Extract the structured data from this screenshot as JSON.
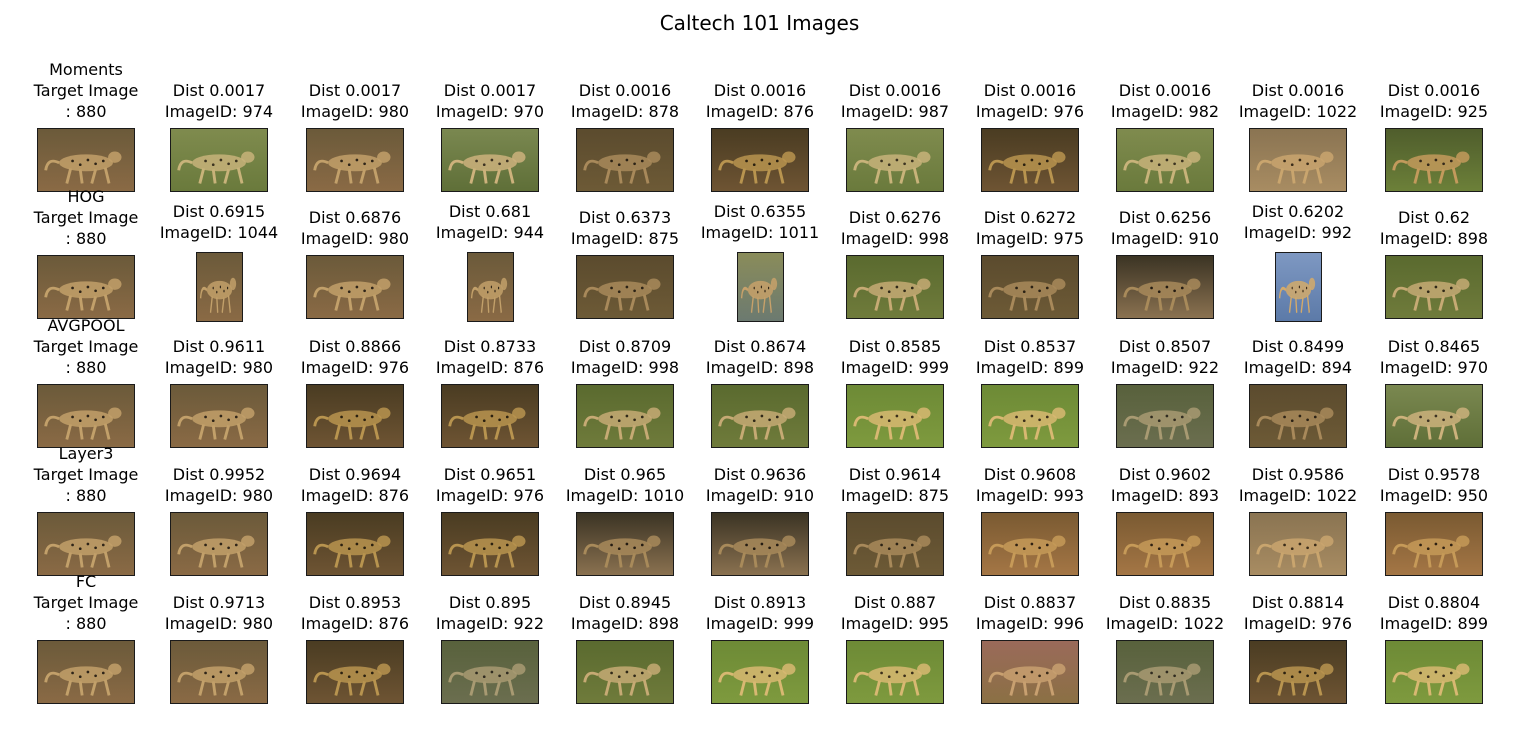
{
  "title": "Caltech 101 Images",
  "rows": [
    {
      "method": "Moments",
      "target": {
        "line1": "Target Image",
        "line2": ": 880",
        "scene": "cheetah-walk-dirt"
      },
      "results": [
        {
          "dist": "Dist 0.0017",
          "id": "ImageID: 974",
          "scene": "cheetahs-grass",
          "shape": "wide"
        },
        {
          "dist": "Dist 0.0017",
          "id": "ImageID: 980",
          "scene": "cheetah-walk-dirt",
          "shape": "wide"
        },
        {
          "dist": "Dist 0.0017",
          "id": "ImageID: 970",
          "scene": "cheetah-grass-run",
          "shape": "wide"
        },
        {
          "dist": "Dist 0.0016",
          "id": "ImageID: 878",
          "scene": "cheetah-dim-field",
          "shape": "wide"
        },
        {
          "dist": "Dist 0.0016",
          "id": "ImageID: 876",
          "scene": "cheetah-walk-dark",
          "shape": "wide"
        },
        {
          "dist": "Dist 0.0016",
          "id": "ImageID: 987",
          "scene": "cheetahs-grass",
          "shape": "wide"
        },
        {
          "dist": "Dist 0.0016",
          "id": "ImageID: 976",
          "scene": "cheetah-walk-dark",
          "shape": "wide"
        },
        {
          "dist": "Dist 0.0016",
          "id": "ImageID: 982",
          "scene": "cheetahs-grass",
          "shape": "wide"
        },
        {
          "dist": "Dist 0.0016",
          "id": "ImageID: 1022",
          "scene": "cheetah-walk-sand",
          "shape": "wide"
        },
        {
          "dist": "Dist 0.0016",
          "id": "ImageID: 925",
          "scene": "cheetah-tree-grass",
          "shape": "wide"
        }
      ]
    },
    {
      "method": "HOG",
      "target": {
        "line1": "Target Image",
        "line2": ": 880",
        "scene": "cheetah-walk-dirt"
      },
      "results": [
        {
          "dist": "Dist 0.6915",
          "id": "ImageID: 1044",
          "scene": "cheetah-walk-dirt",
          "shape": "tall"
        },
        {
          "dist": "Dist 0.6876",
          "id": "ImageID: 980",
          "scene": "cheetah-walk-dirt",
          "shape": "wide"
        },
        {
          "dist": "Dist 0.681",
          "id": "ImageID: 944",
          "scene": "cheetah-walk-dirt",
          "shape": "tall"
        },
        {
          "dist": "Dist 0.6373",
          "id": "ImageID: 875",
          "scene": "cheetah-dim-field",
          "shape": "wide"
        },
        {
          "dist": "Dist 0.6355",
          "id": "ImageID: 1011",
          "scene": "cheetah-water",
          "shape": "tall"
        },
        {
          "dist": "Dist 0.6276",
          "id": "ImageID: 998",
          "scene": "cheetah-grass-walk",
          "shape": "wide"
        },
        {
          "dist": "Dist 0.6272",
          "id": "ImageID: 975",
          "scene": "cheetah-dim-field",
          "shape": "wide"
        },
        {
          "dist": "Dist 0.6256",
          "id": "ImageID: 910",
          "scene": "cheetah-shadow",
          "shape": "wide"
        },
        {
          "dist": "Dist 0.6202",
          "id": "ImageID: 992",
          "scene": "cheetah-face-sky",
          "shape": "tall"
        },
        {
          "dist": "Dist 0.62",
          "id": "ImageID: 898",
          "scene": "cheetah-grass-walk",
          "shape": "wide"
        }
      ]
    },
    {
      "method": "AVGPOOL",
      "target": {
        "line1": "Target Image",
        "line2": ": 880",
        "scene": "cheetah-walk-dirt"
      },
      "results": [
        {
          "dist": "Dist 0.9611",
          "id": "ImageID: 980",
          "scene": "cheetah-walk-dirt",
          "shape": "wide"
        },
        {
          "dist": "Dist 0.8866",
          "id": "ImageID: 976",
          "scene": "cheetah-walk-dark",
          "shape": "wide"
        },
        {
          "dist": "Dist 0.8733",
          "id": "ImageID: 876",
          "scene": "cheetah-walk-dark",
          "shape": "wide"
        },
        {
          "dist": "Dist 0.8709",
          "id": "ImageID: 998",
          "scene": "cheetah-grass-walk",
          "shape": "wide"
        },
        {
          "dist": "Dist 0.8674",
          "id": "ImageID: 898",
          "scene": "cheetah-grass-walk",
          "shape": "wide"
        },
        {
          "dist": "Dist 0.8585",
          "id": "ImageID: 999",
          "scene": "cheetah-bright-grass",
          "shape": "wide"
        },
        {
          "dist": "Dist 0.8537",
          "id": "ImageID: 899",
          "scene": "cheetah-bright-grass",
          "shape": "wide"
        },
        {
          "dist": "Dist 0.8507",
          "id": "ImageID: 922",
          "scene": "cheetah-grey-ground",
          "shape": "wide"
        },
        {
          "dist": "Dist 0.8499",
          "id": "ImageID: 894",
          "scene": "cheetah-dim-field",
          "shape": "wide"
        },
        {
          "dist": "Dist 0.8465",
          "id": "ImageID: 970",
          "scene": "cheetah-grass-run",
          "shape": "wide"
        }
      ]
    },
    {
      "method": "Layer3",
      "target": {
        "line1": "Target Image",
        "line2": ": 880",
        "scene": "cheetah-walk-dirt"
      },
      "results": [
        {
          "dist": "Dist 0.9952",
          "id": "ImageID: 980",
          "scene": "cheetah-walk-dirt",
          "shape": "wide"
        },
        {
          "dist": "Dist 0.9694",
          "id": "ImageID: 876",
          "scene": "cheetah-walk-dark",
          "shape": "wide"
        },
        {
          "dist": "Dist 0.9651",
          "id": "ImageID: 976",
          "scene": "cheetah-walk-dark",
          "shape": "wide"
        },
        {
          "dist": "Dist 0.965",
          "id": "ImageID: 1010",
          "scene": "cheetah-shadow",
          "shape": "wide"
        },
        {
          "dist": "Dist 0.9636",
          "id": "ImageID: 910",
          "scene": "cheetah-shadow",
          "shape": "wide"
        },
        {
          "dist": "Dist 0.9614",
          "id": "ImageID: 875",
          "scene": "cheetah-dim-field",
          "shape": "wide"
        },
        {
          "dist": "Dist 0.9608",
          "id": "ImageID: 993",
          "scene": "cheetah-orange-dirt",
          "shape": "wide"
        },
        {
          "dist": "Dist 0.9602",
          "id": "ImageID: 893",
          "scene": "cheetah-orange-dirt",
          "shape": "wide"
        },
        {
          "dist": "Dist 0.9586",
          "id": "ImageID: 1022",
          "scene": "cheetah-walk-sand",
          "shape": "wide"
        },
        {
          "dist": "Dist 0.9578",
          "id": "ImageID: 950",
          "scene": "cheetah-orange-dirt",
          "shape": "wide"
        }
      ]
    },
    {
      "method": "FC",
      "target": {
        "line1": "Target Image",
        "line2": ": 880",
        "scene": "cheetah-walk-dirt"
      },
      "results": [
        {
          "dist": "Dist 0.9713",
          "id": "ImageID: 980",
          "scene": "cheetah-walk-dirt",
          "shape": "wide"
        },
        {
          "dist": "Dist 0.8953",
          "id": "ImageID: 876",
          "scene": "cheetah-walk-dark",
          "shape": "wide"
        },
        {
          "dist": "Dist 0.895",
          "id": "ImageID: 922",
          "scene": "cheetah-grey-ground",
          "shape": "wide"
        },
        {
          "dist": "Dist 0.8945",
          "id": "ImageID: 898",
          "scene": "cheetah-grass-walk",
          "shape": "wide"
        },
        {
          "dist": "Dist 0.8913",
          "id": "ImageID: 999",
          "scene": "cheetah-bright-grass",
          "shape": "wide"
        },
        {
          "dist": "Dist 0.887",
          "id": "ImageID: 995",
          "scene": "cheetah-bright-grass",
          "shape": "wide"
        },
        {
          "dist": "Dist 0.8837",
          "id": "ImageID: 996",
          "scene": "cheetah-pink-grass",
          "shape": "wide"
        },
        {
          "dist": "Dist 0.8835",
          "id": "ImageID: 1022",
          "scene": "cheetah-grey-ground",
          "shape": "wide"
        },
        {
          "dist": "Dist 0.8814",
          "id": "ImageID: 976",
          "scene": "cheetah-walk-dark",
          "shape": "wide"
        },
        {
          "dist": "Dist 0.8804",
          "id": "ImageID: 899",
          "scene": "cheetah-bright-grass",
          "shape": "wide"
        }
      ]
    }
  ],
  "palette": {
    "cheetah-walk-dirt": {
      "top": "#6b5a3a",
      "bottom": "#8a6a45",
      "cat": "#c2a06a",
      "spot": "#2e2418"
    },
    "cheetah-walk-dark": {
      "top": "#4a3c22",
      "bottom": "#6e5433",
      "cat": "#b8944f",
      "spot": "#2a2010"
    },
    "cheetah-walk-sand": {
      "top": "#8a7452",
      "bottom": "#a88c62",
      "cat": "#c9a56e",
      "spot": "#3a2c1a"
    },
    "cheetahs-grass": {
      "top": "#7f8b4e",
      "bottom": "#6a7a3c",
      "cat": "#c8b37a",
      "spot": "#3b3320"
    },
    "cheetah-grass-run": {
      "top": "#7a8850",
      "bottom": "#5f6f38",
      "cat": "#cdb27c",
      "spot": "#3c3222"
    },
    "cheetah-dim-field": {
      "top": "#5b4b2e",
      "bottom": "#6d5a36",
      "cat": "#a8895a",
      "spot": "#2b2215"
    },
    "cheetah-tree-grass": {
      "top": "#4f5d2c",
      "bottom": "#6c8039",
      "cat": "#c39a5c",
      "spot": "#33281a"
    },
    "cheetah-water": {
      "top": "#8a8c5a",
      "bottom": "#6c7a70",
      "cat": "#c7a16a",
      "spot": "#2d2417"
    },
    "cheetah-grass-walk": {
      "top": "#5a6a2f",
      "bottom": "#6f7b3b",
      "cat": "#c6aa74",
      "spot": "#2f2818"
    },
    "cheetah-shadow": {
      "top": "#3b3424",
      "bottom": "#8a7150",
      "cat": "#a88a5a",
      "spot": "#231b12"
    },
    "cheetah-face-sky": {
      "top": "#7e98c2",
      "bottom": "#5c7aa8",
      "cat": "#d4aa6a",
      "spot": "#3a2a18"
    },
    "cheetah-bright-grass": {
      "top": "#6d8a36",
      "bottom": "#7e9a3e",
      "cat": "#d8b872",
      "spot": "#3a2e1a"
    },
    "cheetah-grey-ground": {
      "top": "#58613c",
      "bottom": "#6b6e4f",
      "cat": "#a89a72",
      "spot": "#2f2b20"
    },
    "cheetah-orange-dirt": {
      "top": "#7a5a32",
      "bottom": "#a47645",
      "cat": "#c69a58",
      "spot": "#2e2012"
    },
    "cheetah-pink-grass": {
      "top": "#9a6a5a",
      "bottom": "#8b7044",
      "cat": "#c8a070",
      "spot": "#3a2a1a"
    }
  }
}
